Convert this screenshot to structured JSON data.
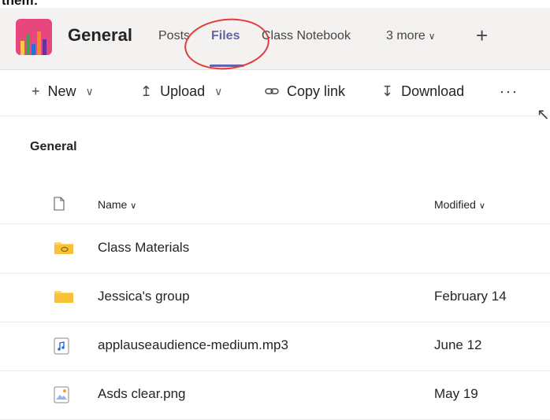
{
  "top_text": "them:",
  "header": {
    "channel_name": "General",
    "tabs": [
      {
        "label": "Posts"
      },
      {
        "label": "Files"
      },
      {
        "label": "Class Notebook"
      },
      {
        "label": "3 more"
      }
    ],
    "accent_color": "#6264a7",
    "annotation_color": "#e03a3a"
  },
  "toolbar": {
    "new_label": "New",
    "upload_label": "Upload",
    "copy_link_label": "Copy link",
    "download_label": "Download"
  },
  "breadcrumb": "General",
  "list": {
    "columns": {
      "name": "Name",
      "modified": "Modified"
    },
    "rows": [
      {
        "icon": "shared-folder-icon",
        "name": "Class Materials",
        "modified": ""
      },
      {
        "icon": "folder-icon",
        "name": "Jessica's group",
        "modified": "February 14"
      },
      {
        "icon": "audio-file-icon",
        "name": "applauseaudience-medium.mp3",
        "modified": "June 12"
      },
      {
        "icon": "image-file-icon",
        "name": "Asds clear.png",
        "modified": "May 19"
      }
    ]
  }
}
